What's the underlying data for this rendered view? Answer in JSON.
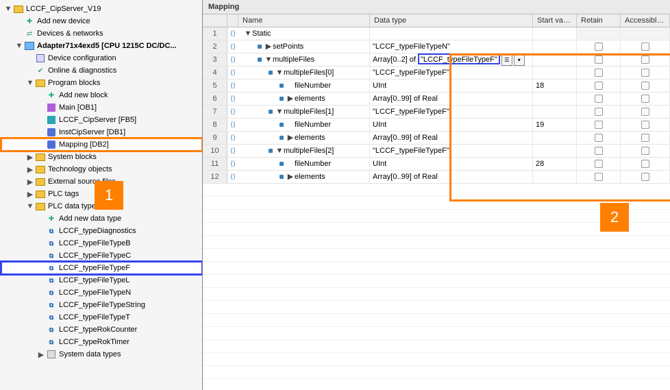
{
  "tree": {
    "root": "LCCF_CipServer_V19",
    "items": [
      {
        "depth": 1,
        "twist": "open",
        "icon": "folder",
        "label": "LCCF_CipServer_V19"
      },
      {
        "depth": 2,
        "twist": "none",
        "icon": "addblk",
        "label": "Add new device"
      },
      {
        "depth": 2,
        "twist": "none",
        "icon": "net",
        "label": "Devices & networks"
      },
      {
        "depth": 2,
        "twist": "open",
        "icon": "cpu",
        "label": "Adapter71x4exd5 [CPU 1215C DC/DC...",
        "bold": true
      },
      {
        "depth": 3,
        "twist": "none",
        "icon": "dev",
        "label": "Device configuration"
      },
      {
        "depth": 3,
        "twist": "none",
        "icon": "diag",
        "label": "Online & diagnostics"
      },
      {
        "depth": 3,
        "twist": "open",
        "icon": "folder",
        "label": "Program blocks"
      },
      {
        "depth": 4,
        "twist": "none",
        "icon": "addblk",
        "label": "Add new block"
      },
      {
        "depth": 4,
        "twist": "none",
        "icon": "ob",
        "label": "Main [OB1]"
      },
      {
        "depth": 4,
        "twist": "none",
        "icon": "fb",
        "label": "LCCF_CipServer [FB5]"
      },
      {
        "depth": 4,
        "twist": "none",
        "icon": "db",
        "label": "InstCipServer [DB1]"
      },
      {
        "depth": 4,
        "twist": "none",
        "icon": "db",
        "label": "Mapping [DB2]",
        "hl": "orange"
      },
      {
        "depth": 3,
        "twist": "closed",
        "icon": "folder",
        "label": "System blocks"
      },
      {
        "depth": 3,
        "twist": "closed",
        "icon": "folder",
        "label": "Technology objects"
      },
      {
        "depth": 3,
        "twist": "closed",
        "icon": "folder",
        "label": "External source files"
      },
      {
        "depth": 3,
        "twist": "closed",
        "icon": "folder",
        "label": "PLC tags"
      },
      {
        "depth": 3,
        "twist": "open",
        "icon": "folder",
        "label": "PLC data types"
      },
      {
        "depth": 4,
        "twist": "none",
        "icon": "addblk",
        "label": "Add new data type"
      },
      {
        "depth": 4,
        "twist": "none",
        "icon": "type",
        "label": "LCCF_typeDiagnostics"
      },
      {
        "depth": 4,
        "twist": "none",
        "icon": "type",
        "label": "LCCF_typeFileTypeB"
      },
      {
        "depth": 4,
        "twist": "none",
        "icon": "type",
        "label": "LCCF_typeFileTypeC"
      },
      {
        "depth": 4,
        "twist": "none",
        "icon": "type",
        "label": "LCCF_typeFileTypeF",
        "hl": "blue"
      },
      {
        "depth": 4,
        "twist": "none",
        "icon": "type",
        "label": "LCCF_typeFileTypeL"
      },
      {
        "depth": 4,
        "twist": "none",
        "icon": "type",
        "label": "LCCF_typeFileTypeN"
      },
      {
        "depth": 4,
        "twist": "none",
        "icon": "type",
        "label": "LCCF_typeFileTypeString"
      },
      {
        "depth": 4,
        "twist": "none",
        "icon": "type",
        "label": "LCCF_typeFileTypeT"
      },
      {
        "depth": 4,
        "twist": "none",
        "icon": "type",
        "label": "LCCF_typeRokCounter"
      },
      {
        "depth": 4,
        "twist": "none",
        "icon": "type",
        "label": "LCCF_typeRokTimer"
      },
      {
        "depth": 4,
        "twist": "closed",
        "icon": "sys",
        "label": "System data types"
      }
    ]
  },
  "badges": {
    "one": "1",
    "two": "2"
  },
  "grid": {
    "title": "Mapping",
    "headers": [
      "",
      "Name",
      "Data type",
      "Start value",
      "Retain",
      "Accessible f..."
    ],
    "rows": [
      {
        "n": "1",
        "depth": 0,
        "caret": "down",
        "name": "Static",
        "type": "",
        "start": "",
        "retCell": "ro",
        "accCell": "ro"
      },
      {
        "n": "2",
        "depth": 1,
        "pre": "dot",
        "caret": "right",
        "name": "setPoints",
        "type": "\"LCCF_typeFileTypeN\"",
        "start": ""
      },
      {
        "n": "3",
        "depth": 1,
        "pre": "dot",
        "caret": "down",
        "name": "multipleFiles",
        "typeSpecial": true,
        "typePrefix": "Array[0..2] of ",
        "typeValue": "LCCF_typeFileTypeF",
        "start": ""
      },
      {
        "n": "4",
        "depth": 2,
        "pre": "dot",
        "caret": "down",
        "name": "multipleFiles[0]",
        "type": "\"LCCF_typeFileTypeF\"",
        "start": ""
      },
      {
        "n": "5",
        "depth": 3,
        "pre": "dot",
        "caret": "",
        "name": "fileNumber",
        "type": "UInt",
        "start": "18"
      },
      {
        "n": "6",
        "depth": 3,
        "pre": "dot",
        "caret": "right",
        "name": "elements",
        "type": "Array[0..99] of Real",
        "start": ""
      },
      {
        "n": "7",
        "depth": 2,
        "pre": "dot",
        "caret": "down",
        "name": "multipleFiles[1]",
        "type": "\"LCCF_typeFileTypeF\"",
        "start": ""
      },
      {
        "n": "8",
        "depth": 3,
        "pre": "dot",
        "caret": "",
        "name": "fileNumber",
        "type": "UInt",
        "start": "19"
      },
      {
        "n": "9",
        "depth": 3,
        "pre": "dot",
        "caret": "right",
        "name": "elements",
        "type": "Array[0..99] of Real",
        "start": ""
      },
      {
        "n": "10",
        "depth": 2,
        "pre": "dot",
        "caret": "down",
        "name": "multipleFiles[2]",
        "type": "\"LCCF_typeFileTypeF\"",
        "start": ""
      },
      {
        "n": "11",
        "depth": 3,
        "pre": "dot",
        "caret": "",
        "name": "fileNumber",
        "type": "UInt",
        "start": "28"
      },
      {
        "n": "12",
        "depth": 3,
        "pre": "dot",
        "caret": "right",
        "name": "elements",
        "type": "Array[0..99] of Real",
        "start": ""
      }
    ]
  }
}
